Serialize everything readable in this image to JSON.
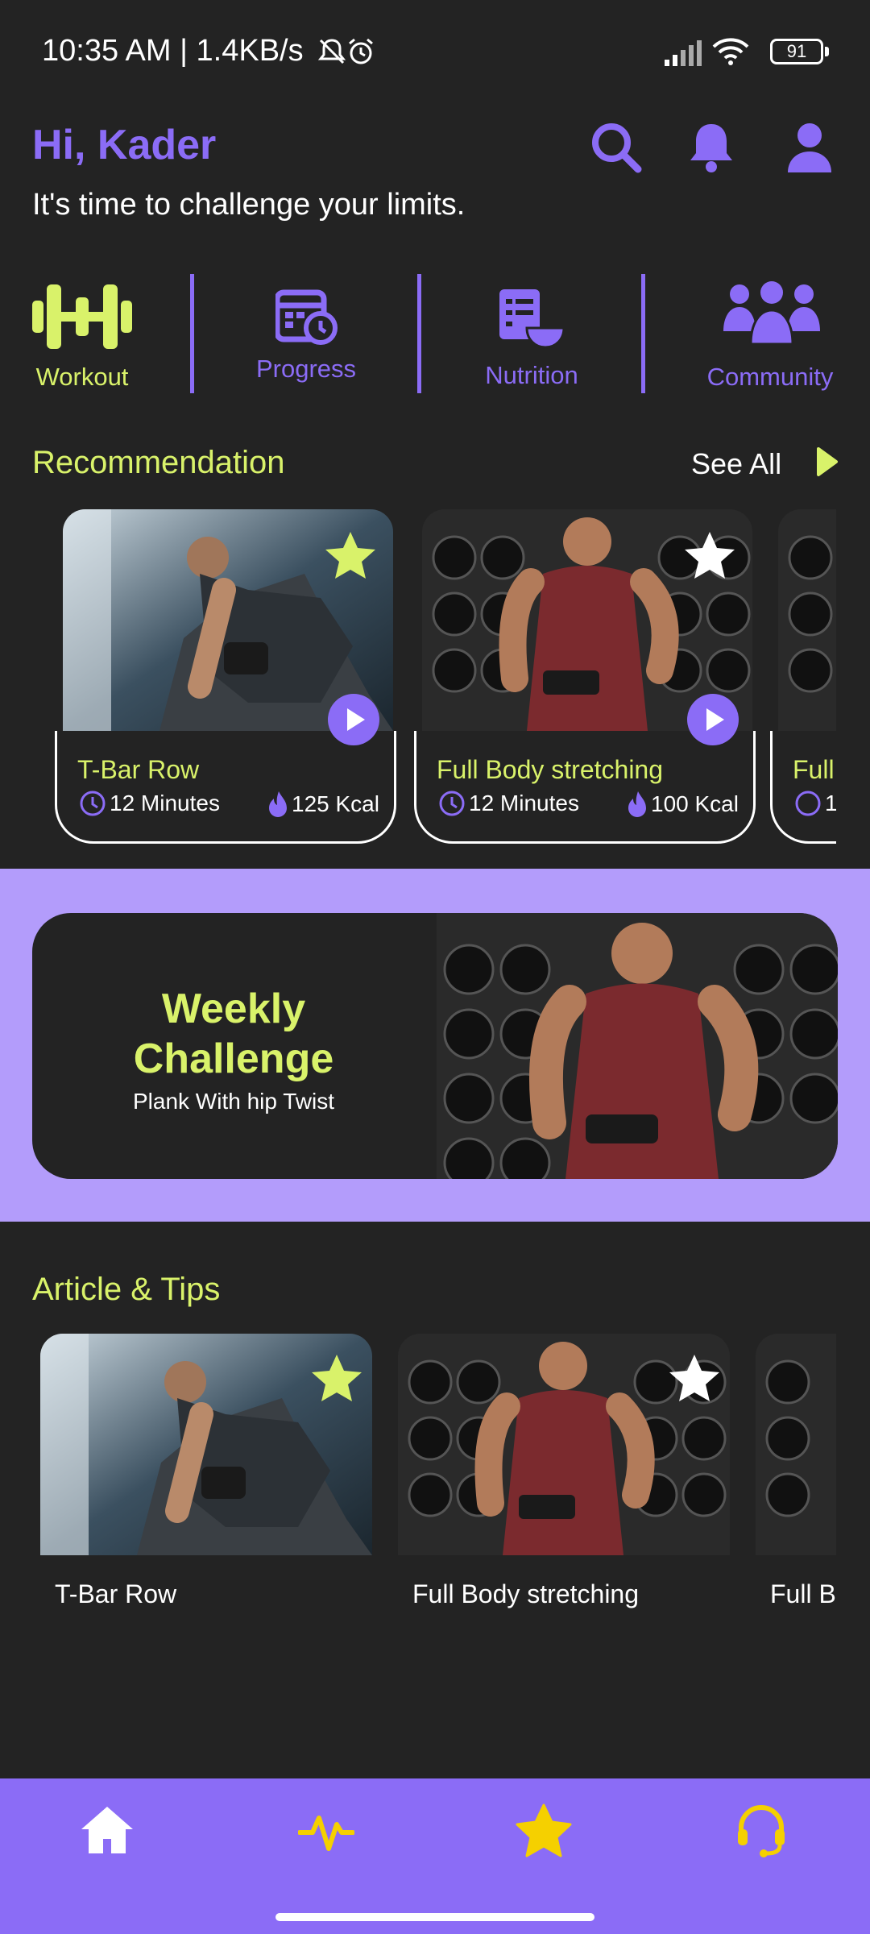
{
  "status_bar": {
    "time_text": "10:35 AM | 1.4KB/s",
    "battery": "91"
  },
  "header": {
    "greeting": "Hi, Kader",
    "tagline": "It's time to challenge your limits.",
    "icons": [
      "search-icon",
      "bell-icon",
      "profile-icon"
    ]
  },
  "categories": [
    {
      "label": "Workout",
      "icon": "dumbbell-icon",
      "color": "#d9f26a"
    },
    {
      "label": "Progress",
      "icon": "progress-calendar-icon",
      "color": "#8b6cf6"
    },
    {
      "label": "Nutrition",
      "icon": "nutrition-icon",
      "color": "#8b6cf6"
    },
    {
      "label": "Community",
      "icon": "community-icon",
      "color": "#8b6cf6"
    }
  ],
  "recommendation": {
    "title": "Recommendation",
    "see_all": "See All",
    "cards": [
      {
        "title": "T-Bar Row",
        "duration": "12 Minutes",
        "kcal": "125 Kcal",
        "favorite": true
      },
      {
        "title": "Full Body stretching",
        "duration": "12 Minutes",
        "kcal": "100 Kcal",
        "favorite": false
      },
      {
        "title": "Full",
        "duration": "1",
        "kcal": "",
        "favorite": false
      }
    ]
  },
  "weekly_challenge": {
    "title_line1": "Weekly",
    "title_line2": "Challenge",
    "subtitle": "Plank With hip Twist"
  },
  "articles": {
    "title": "Article & Tips",
    "items": [
      {
        "title": "T-Bar Row",
        "favorite": true
      },
      {
        "title": "Full Body stretching",
        "favorite": false
      },
      {
        "title": "Full B",
        "favorite": false
      }
    ]
  },
  "bottom_nav": {
    "items": [
      "home-icon",
      "activity-icon",
      "star-icon",
      "support-headset-icon"
    ]
  },
  "colors": {
    "accent_purple": "#8b6cf6",
    "accent_lime": "#d9f26a",
    "background": "#232323",
    "band": "#b39cfb"
  }
}
